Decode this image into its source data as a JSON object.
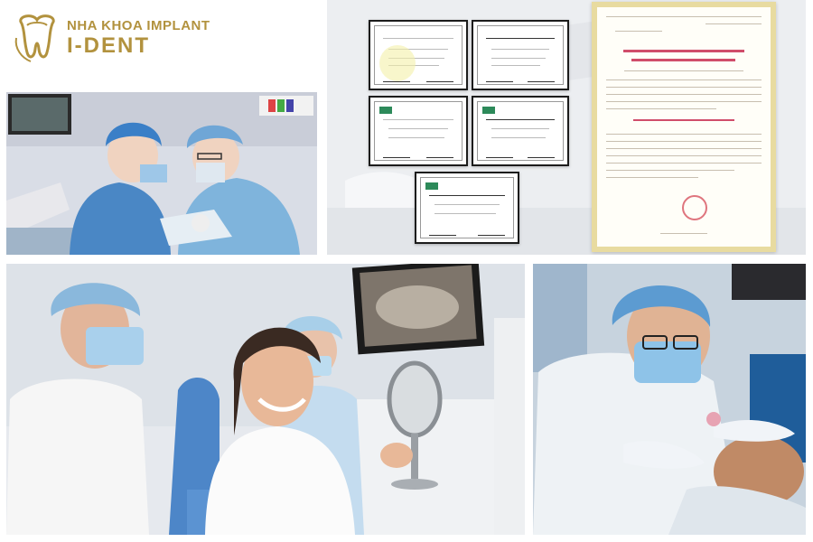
{
  "brand": {
    "name_line1": "NHA KHOA IMPLANT",
    "name_line2": "I-DENT",
    "color": "#b2923e"
  },
  "photos": {
    "surgery": "surgery-photo",
    "certificates": "certificates-photo",
    "consultation": "consultation-photo",
    "treatment": "treatment-photo"
  },
  "colors": {
    "scrub_blue": "#7fb4dc",
    "cap_blue": "#3a7fc7",
    "license_border": "#e8dba0",
    "license_red": "#d04d6a"
  }
}
